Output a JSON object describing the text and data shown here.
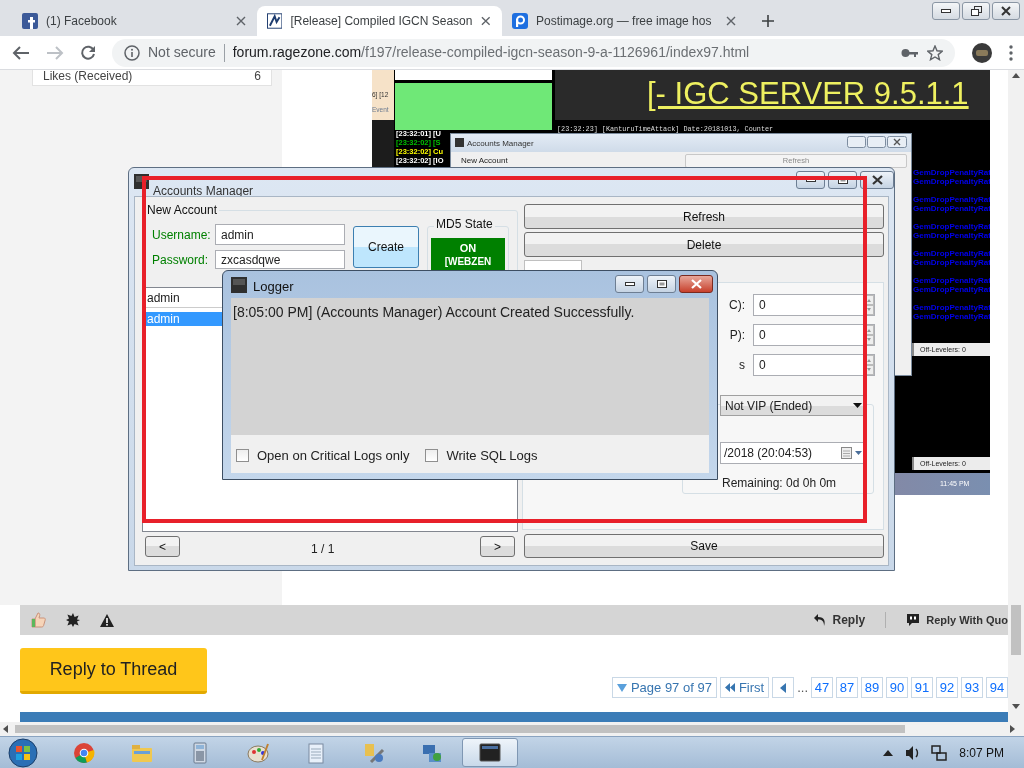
{
  "browser": {
    "tabs": [
      {
        "title": "(1) Facebook",
        "selected": false
      },
      {
        "title": "[Release] Compiled IGCN Season",
        "selected": true
      },
      {
        "title": "Postimage.org — free image hos",
        "selected": false
      }
    ],
    "security": "Not secure",
    "url_host": "forum.ragezone.com",
    "url_path": "/f197/release-compiled-igcn-season-9-a-1126961/index97.html"
  },
  "sidebar": {
    "stat_label": "Likes (Received)",
    "stat_value": "6"
  },
  "post_image": {
    "side_texts": [
      "6] [12",
      "Event"
    ],
    "banner": "[- IGC SERVER 9.5.1.1",
    "console_lines": [
      {
        "text": "[23:32:01] [U",
        "color": "#ffffff"
      },
      {
        "text": "[23:32:02] [S",
        "color": "#00c000"
      },
      {
        "text": "[23:32:02] Cu",
        "color": "#ffff00"
      },
      {
        "text": "[23:32:02] [IO",
        "color": "#ffffff"
      }
    ],
    "log_line": "[23:32:23] [KanturuTimeAttack] Date:20181013, Counter",
    "window": {
      "title": "Accounts Manager",
      "group": "New Account",
      "button": "Refresh"
    },
    "config_lines": [
      "GemDropPenaltyRat",
      "GemDropPenaltyRat",
      "GemDropPenaltyRat",
      "GemDropPenaltyRat",
      "GemDropPenaltyRat",
      "GemDropPenaltyRat",
      "GemDropPenaltyRat",
      "GemDropPenaltyRat",
      "GemDropPenaltyRat",
      "GemDropPenaltyRat",
      "GemDropPenaltyRat",
      "GemDropPenaltyRat"
    ],
    "status_bars": [
      "Off-Levelers: 0",
      "Off-Levelers: 0"
    ],
    "clock": "11:45 PM"
  },
  "post_footer": {
    "reply": "Reply",
    "reply_quote": "Reply With Quo"
  },
  "reply_button": "Reply to Thread",
  "pagination": {
    "summary": "Page 97 of 97",
    "first": "First",
    "ellipsis": "...",
    "pages": [
      "47",
      "87",
      "89",
      "90",
      "91",
      "92",
      "93",
      "94"
    ]
  },
  "accounts_manager": {
    "title": "Accounts Manager",
    "group": "New Account",
    "username_label": "Username:",
    "username": "admin",
    "password_label": "Password:",
    "password": "zxcasdqwe",
    "create": "Create",
    "md5_legend": "MD5 State",
    "md5_state": "ON",
    "md5_detail": "[WEBZEN",
    "md5_on": true,
    "search": "admin",
    "accounts": [
      {
        "name": "admin",
        "selected": true
      }
    ],
    "prev": "<",
    "page_info": "1 / 1",
    "next": ">",
    "refresh": "Refresh",
    "delete": "Delete",
    "fields": [
      {
        "label": "C):",
        "value": "0"
      },
      {
        "label": "P):",
        "value": "0"
      },
      {
        "label": "s",
        "value": "0"
      }
    ],
    "vip": "Not VIP (Ended)",
    "date": "/2018 (20:04:53)",
    "remaining": "Remaining: 0d 0h 0m",
    "save": "Save"
  },
  "logger": {
    "title": "Logger",
    "lines": [
      "[8:05:00 PM] (Accounts Manager) Account Created Successfully."
    ],
    "options": [
      {
        "label": "Open on Critical Logs only",
        "checked": false
      },
      {
        "label": "Write SQL Logs",
        "checked": false
      }
    ]
  },
  "taskbar": {
    "apps": [
      {
        "kind": "chrome",
        "selected": false
      },
      {
        "kind": "explorer",
        "selected": false
      },
      {
        "kind": "calculator",
        "selected": false
      },
      {
        "kind": "paint",
        "selected": false
      },
      {
        "kind": "notepad",
        "selected": false
      },
      {
        "kind": "tool",
        "selected": false
      },
      {
        "kind": "network",
        "selected": false
      },
      {
        "kind": "console",
        "selected": true
      }
    ],
    "clock": "8:07 PM"
  }
}
